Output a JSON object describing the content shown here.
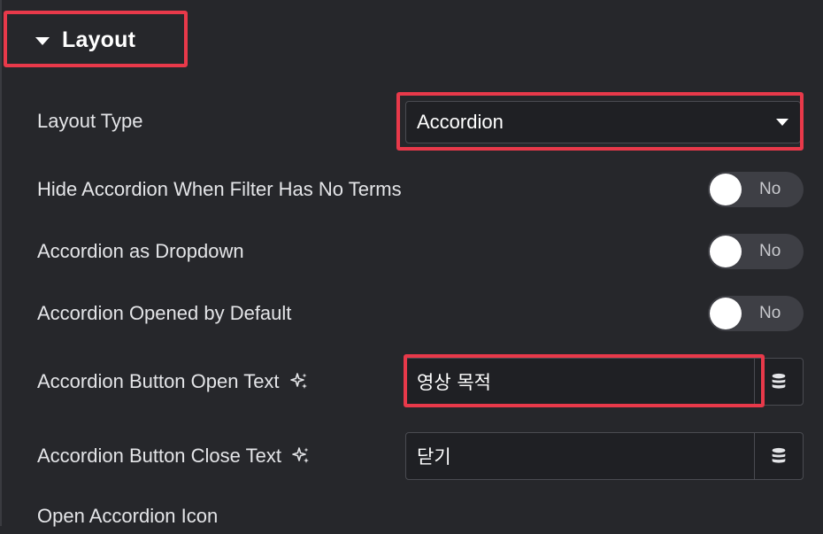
{
  "section": {
    "title": "Layout"
  },
  "layout_type": {
    "label": "Layout Type",
    "value": "Accordion"
  },
  "hide_accordion": {
    "label": "Hide Accordion When Filter Has No Terms",
    "toggle_text": "No"
  },
  "accordion_dropdown": {
    "label": "Accordion as Dropdown",
    "toggle_text": "No"
  },
  "accordion_opened": {
    "label": "Accordion Opened by Default",
    "toggle_text": "No"
  },
  "open_text": {
    "label": "Accordion Button Open Text",
    "value": "영상 목적"
  },
  "close_text": {
    "label": "Accordion Button Close Text",
    "value": "닫기"
  },
  "open_icon": {
    "label": "Open Accordion Icon"
  },
  "colors": {
    "background": "#26272b",
    "highlight": "#e8394a",
    "toggle_track": "#3e3f45",
    "input_bg": "#1f2024"
  },
  "icons": {
    "ai": "sparkle-icon",
    "dynamic": "database-icon",
    "collapse": "caret-down-icon"
  }
}
